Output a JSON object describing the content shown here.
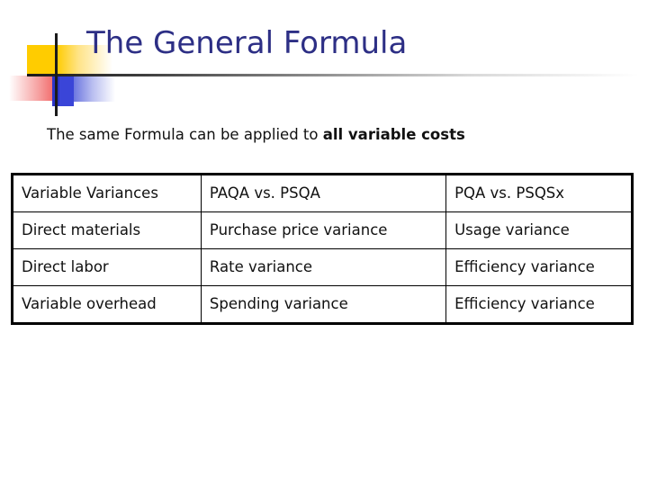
{
  "slide": {
    "title": "The General Formula",
    "subtitle": {
      "normal": "The same Formula can be applied to ",
      "emphasis": "all variable costs"
    },
    "colors": {
      "title": "#2D2F85",
      "body_text": "#111111",
      "deco_yellow": "#FFCC00",
      "deco_blue": "#2B35C8",
      "deco_red": "#EF4B4B",
      "rule": "#1A1A1A",
      "table_border": "#000000",
      "background": "#FFFFFF"
    }
  },
  "table": {
    "headers": [
      "Variable Variances",
      "PAQA vs. PSQA",
      "PQA vs. PSQSx"
    ],
    "rows": [
      [
        "Direct materials",
        "Purchase price variance",
        "Usage variance"
      ],
      [
        "Direct labor",
        "Rate variance",
        "Efficiency variance"
      ],
      [
        "Variable overhead",
        "Spending variance",
        "Efficiency variance"
      ]
    ]
  }
}
